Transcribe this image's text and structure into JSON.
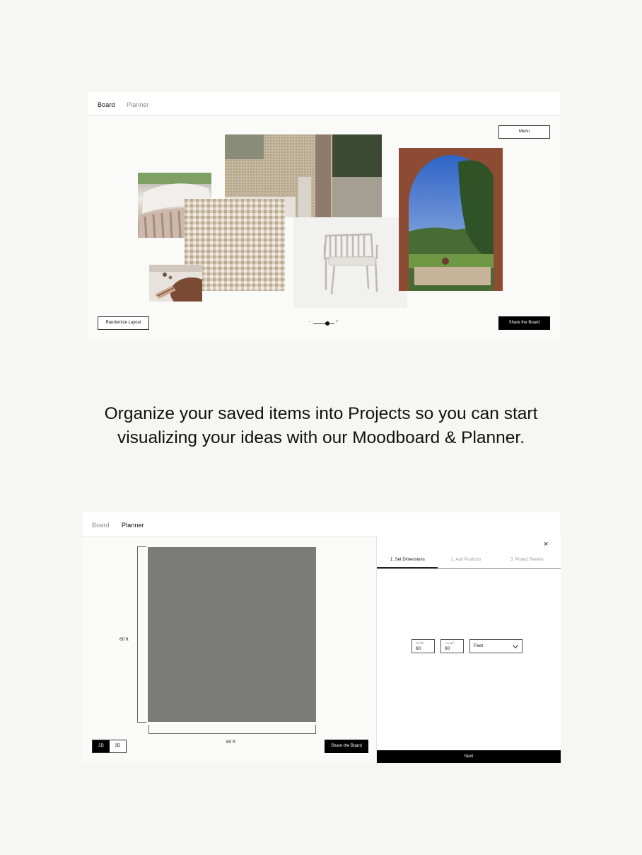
{
  "board_panel": {
    "tabs": [
      {
        "label": "Board",
        "active": true
      },
      {
        "label": "Planner",
        "active": false
      }
    ],
    "menu_label": "Menu",
    "randomize_label": "Randomize Layout",
    "zoom": {
      "minus": "-",
      "plus": "+",
      "level": 0.5
    },
    "share_label": "Share the Board"
  },
  "headline": {
    "line1": "Organize your saved items into Projects so you can start",
    "line2": "visualizing your ideas with our Moodboard & Planner."
  },
  "planner_panel": {
    "tabs": [
      {
        "label": "Board",
        "active": false
      },
      {
        "label": "Planner",
        "active": true
      }
    ],
    "dimension_height": "60 ft",
    "dimension_width": "60 ft",
    "view_toggle": {
      "options": [
        "2D",
        "3D"
      ],
      "selected": "2D"
    },
    "share_label": "Share the Board",
    "sidebar": {
      "close_icon": "close-icon",
      "steps": [
        "1. Set Dimensions",
        "2. Add Products",
        "3. Project Review"
      ],
      "active_step": 0,
      "width_label": "Width",
      "width_value": "60",
      "length_label": "Length",
      "length_value": "60",
      "unit_value": "Feet",
      "next_label": "Next"
    }
  },
  "colors": {
    "background": "#f6f6f2",
    "room_fill": "#7b7b79",
    "button_dark": "#000000"
  }
}
